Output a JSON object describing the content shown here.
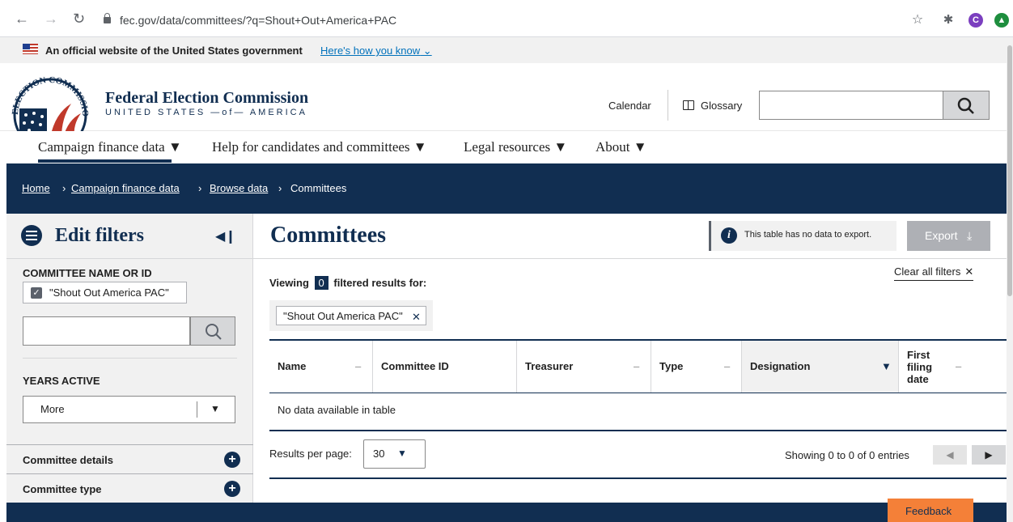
{
  "browser": {
    "url": "fec.gov/data/committees/?q=Shout+Out+America+PAC",
    "profile_initial": "C",
    "colors": {
      "profile": "#7b3fbf",
      "extension": "#1e8e3e"
    }
  },
  "gov_banner": {
    "text": "An official website of the United States government",
    "link": "Here's how you know"
  },
  "header": {
    "title": "Federal Election Commission",
    "subtitle": "UNITED STATES —of— AMERICA",
    "seal_text": "ELECTION COMMISSION",
    "calendar": "Calendar",
    "glossary": "Glossary",
    "search_value": ""
  },
  "main_nav": [
    {
      "label": "Campaign finance data ▼"
    },
    {
      "label": "Help for candidates and committees ▼"
    },
    {
      "label": "Legal resources ▼"
    },
    {
      "label": "About ▼"
    }
  ],
  "breadcrumb": {
    "items": [
      "Home",
      "Campaign finance data",
      "Browse data",
      "Committees"
    ],
    "separator": "›"
  },
  "sidebar": {
    "title": "Edit filters",
    "collapse_icon": "◀❙",
    "name_filter": {
      "label": "COMMITTEE NAME OR ID",
      "checked_value": "\"Shout Out America PAC\"",
      "input_value": ""
    },
    "years_active": {
      "label": "YEARS ACTIVE",
      "selected": "More"
    },
    "accordions": [
      {
        "label": "Committee details"
      },
      {
        "label": "Committee type"
      }
    ]
  },
  "main": {
    "title": "Committees",
    "export_notice": "This table has no data to export.",
    "export_label": "Export",
    "viewing_prefix": "Viewing",
    "viewing_count": "0",
    "viewing_suffix": "filtered results for:",
    "clear_filters": "Clear all filters",
    "query_tag": "\"Shout Out America PAC\"",
    "table": {
      "columns": [
        {
          "label": "Name"
        },
        {
          "label": "Committee ID"
        },
        {
          "label": "Treasurer"
        },
        {
          "label": "Type"
        },
        {
          "label": "Designation"
        },
        {
          "label": "First filing date"
        }
      ],
      "rows": [],
      "empty_message": "No data available in table"
    },
    "pagination": {
      "per_page_label": "Results per page:",
      "per_page_value": "30",
      "showing": "Showing 0 to 0 of 0 entries"
    }
  },
  "feedback": "Feedback",
  "colors": {
    "navy": "#112e51",
    "feedback": "#f48038",
    "link": "#0071bb"
  }
}
